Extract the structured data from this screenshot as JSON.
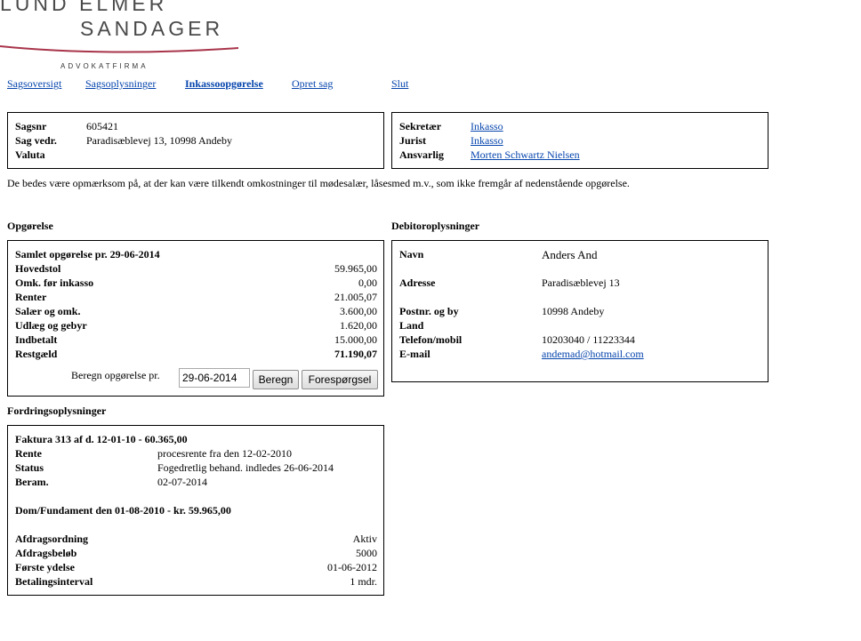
{
  "logo": {
    "line1": "LUND ELMER",
    "line2": "SANDAGER",
    "tagline": "ADVOKATFIRMA"
  },
  "nav": [
    {
      "label": "Sagsoversigt"
    },
    {
      "label": "Sagsoplysninger"
    },
    {
      "label": "Inkassoopgørelse"
    },
    {
      "label": "Opret sag"
    },
    {
      "label": "Slut"
    }
  ],
  "case": {
    "sagsnr_label": "Sagsnr",
    "sagsnr": "605421",
    "sagvedr_label": "Sag vedr.",
    "sagvedr": "Paradisæblevej 13, 10998 Andeby",
    "valuta_label": "Valuta",
    "valuta": ""
  },
  "staff": {
    "sekretaer_label": "Sekretær",
    "sekretaer": "Inkasso",
    "jurist_label": "Jurist",
    "jurist": "Inkasso",
    "ansvarlig_label": "Ansvarlig",
    "ansvarlig": "Morten Schwartz Nielsen"
  },
  "notice": "De bedes være opmærksom på, at der kan være tilkendt omkostninger til mødesalær, låsesmed m.v., som ikke fremgår af nedenstående opgørelse.",
  "opgorelse": {
    "section_title": "Opgørelse",
    "heading": "Samlet opgørelse pr. 29-06-2014",
    "rows": [
      {
        "label": "Hovedstol",
        "value": "59.965,00"
      },
      {
        "label": "Omk. før inkasso",
        "value": "0,00"
      },
      {
        "label": "Renter",
        "value": "21.005,07"
      },
      {
        "label": "Salær og omk.",
        "value": "3.600,00"
      },
      {
        "label": "Udlæg og gebyr",
        "value": "1.620,00"
      },
      {
        "label": "Indbetalt",
        "value": "15.000,00"
      },
      {
        "label": "Restgæld",
        "value": "71.190,07"
      }
    ],
    "beregn_label": "Beregn opgørelse pr.",
    "date_value": "29-06-2014",
    "beregn_button": "Beregn",
    "foresp_button": "Forespørgsel"
  },
  "debitor": {
    "section_title": "Debitoroplysninger",
    "navn_label": "Navn",
    "navn": "Anders And",
    "adresse_label": "Adresse",
    "adresse": "Paradisæblevej 13",
    "postnr_label": "Postnr. og by",
    "postnr": "10998 Andeby",
    "land_label": "Land",
    "land": "",
    "telefon_label": "Telefon/mobil",
    "telefon": "10203040 / 11223344",
    "email_label": "E-mail",
    "email": "andemad@hotmail.com"
  },
  "fordring": {
    "section_title": "Fordringsoplysninger",
    "faktura_heading": "Faktura 313 af d. 12-01-10 - 60.365,00",
    "rente_label": "Rente",
    "rente": "procesrente fra den 12-02-2010",
    "status_label": "Status",
    "status": "Fogedretlig behand. indledes 26-06-2014",
    "beram_label": "Beram.",
    "beram": "02-07-2014",
    "dom_heading": "Dom/Fundament den 01-08-2010 - kr. 59.965,00",
    "rows": [
      {
        "label": "Afdragsordning",
        "value": "Aktiv"
      },
      {
        "label": "Afdragsbeløb",
        "value": "5000"
      },
      {
        "label": "Første ydelse",
        "value": "01-06-2012"
      },
      {
        "label": "Betalingsinterval",
        "value": "1 mdr."
      }
    ]
  },
  "colors": {
    "link": "#0645ad",
    "logo_arc": "#a8344a",
    "logo_text": "#4a4a4a"
  }
}
